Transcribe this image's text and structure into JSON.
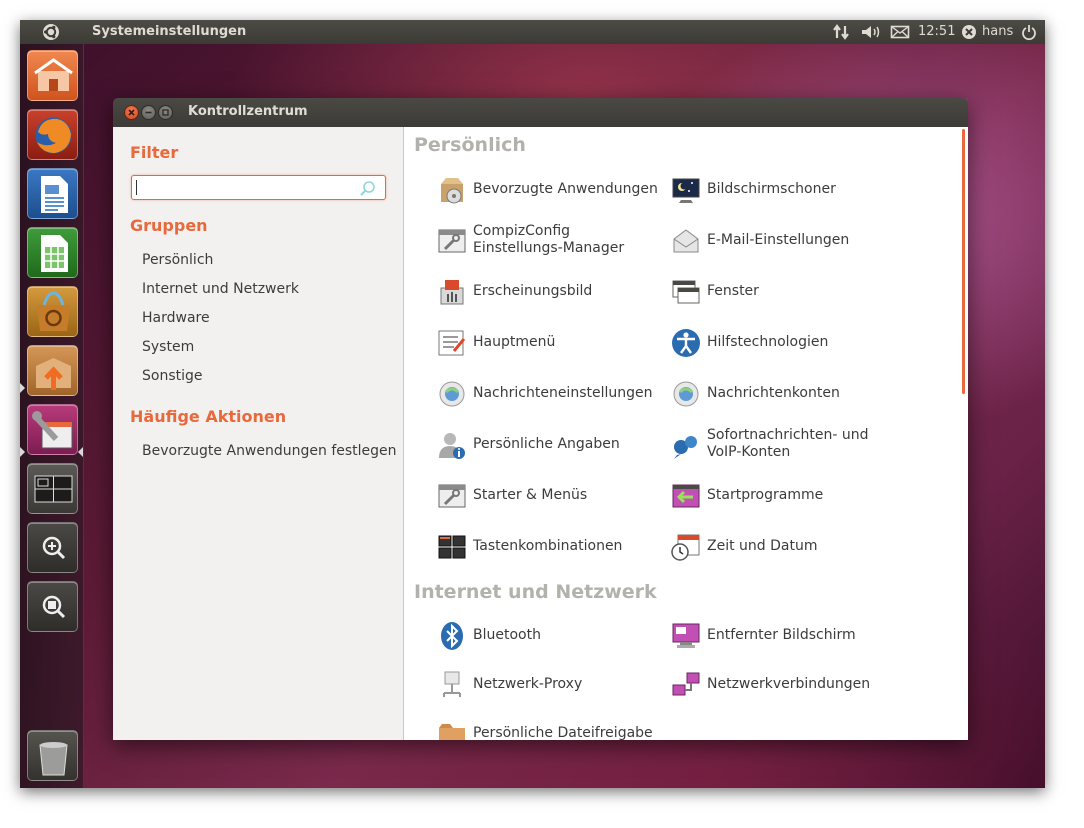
{
  "top_panel": {
    "title": "Systemeinstellungen",
    "clock": "12:51",
    "user": "hans"
  },
  "launcher": {
    "items": [
      "home-folder-icon",
      "firefox-icon",
      "writer-icon",
      "calc-icon",
      "software-center-icon",
      "update-manager-icon",
      "system-settings-icon",
      "workspace-switcher-icon",
      "zoom-in-icon",
      "zoom-fit-icon",
      "trash-icon"
    ]
  },
  "window": {
    "title": "Kontrollzentrum"
  },
  "sidebar": {
    "filter_heading": "Filter",
    "search_value": "",
    "groups_heading": "Gruppen",
    "groups": [
      "Persönlich",
      "Internet und Netzwerk",
      "Hardware",
      "System",
      "Sonstige"
    ],
    "actions_heading": "Häufige Aktionen",
    "actions": [
      "Bevorzugte Anwendungen festlegen"
    ]
  },
  "content": {
    "categories": [
      {
        "title": "Persönlich",
        "items": [
          {
            "label": "Bevorzugte Anwendungen",
            "icon": "preferred-apps-icon"
          },
          {
            "label": "Bildschirmschoner",
            "icon": "screensaver-icon"
          },
          {
            "label": "CompizConfig\nEinstellungs-Manager",
            "icon": "compizconfig-icon"
          },
          {
            "label": "E-Mail-Einstellungen",
            "icon": "email-settings-icon"
          },
          {
            "label": "Erscheinungsbild",
            "icon": "appearance-icon"
          },
          {
            "label": "Fenster",
            "icon": "windows-icon"
          },
          {
            "label": "Hauptmenü",
            "icon": "main-menu-icon"
          },
          {
            "label": "Hilfstechnologien",
            "icon": "accessibility-icon"
          },
          {
            "label": "Nachrichteneinstellungen",
            "icon": "messaging-settings-icon"
          },
          {
            "label": "Nachrichtenkonten",
            "icon": "messaging-accounts-icon"
          },
          {
            "label": "Persönliche Angaben",
            "icon": "about-me-icon"
          },
          {
            "label": "Sofortnachrichten- und\nVoIP-Konten",
            "icon": "im-voip-icon"
          },
          {
            "label": "Starter & Menüs",
            "icon": "launchers-menus-icon"
          },
          {
            "label": "Startprogramme",
            "icon": "startup-apps-icon"
          },
          {
            "label": "Tastenkombinationen",
            "icon": "keyboard-shortcuts-icon"
          },
          {
            "label": "Zeit und Datum",
            "icon": "time-date-icon"
          }
        ]
      },
      {
        "title": "Internet und Netzwerk",
        "items": [
          {
            "label": "Bluetooth",
            "icon": "bluetooth-icon"
          },
          {
            "label": "Entfernter Bildschirm",
            "icon": "remote-desktop-icon"
          },
          {
            "label": "Netzwerk-Proxy",
            "icon": "network-proxy-icon"
          },
          {
            "label": "Netzwerkverbindungen",
            "icon": "network-connections-icon"
          },
          {
            "label": "Persönliche Dateifreigabe",
            "icon": "file-sharing-icon"
          }
        ]
      }
    ]
  },
  "colors": {
    "accent": "#e8693b",
    "panel": "#3c3b37",
    "heading_gray": "#b3b1ac"
  }
}
